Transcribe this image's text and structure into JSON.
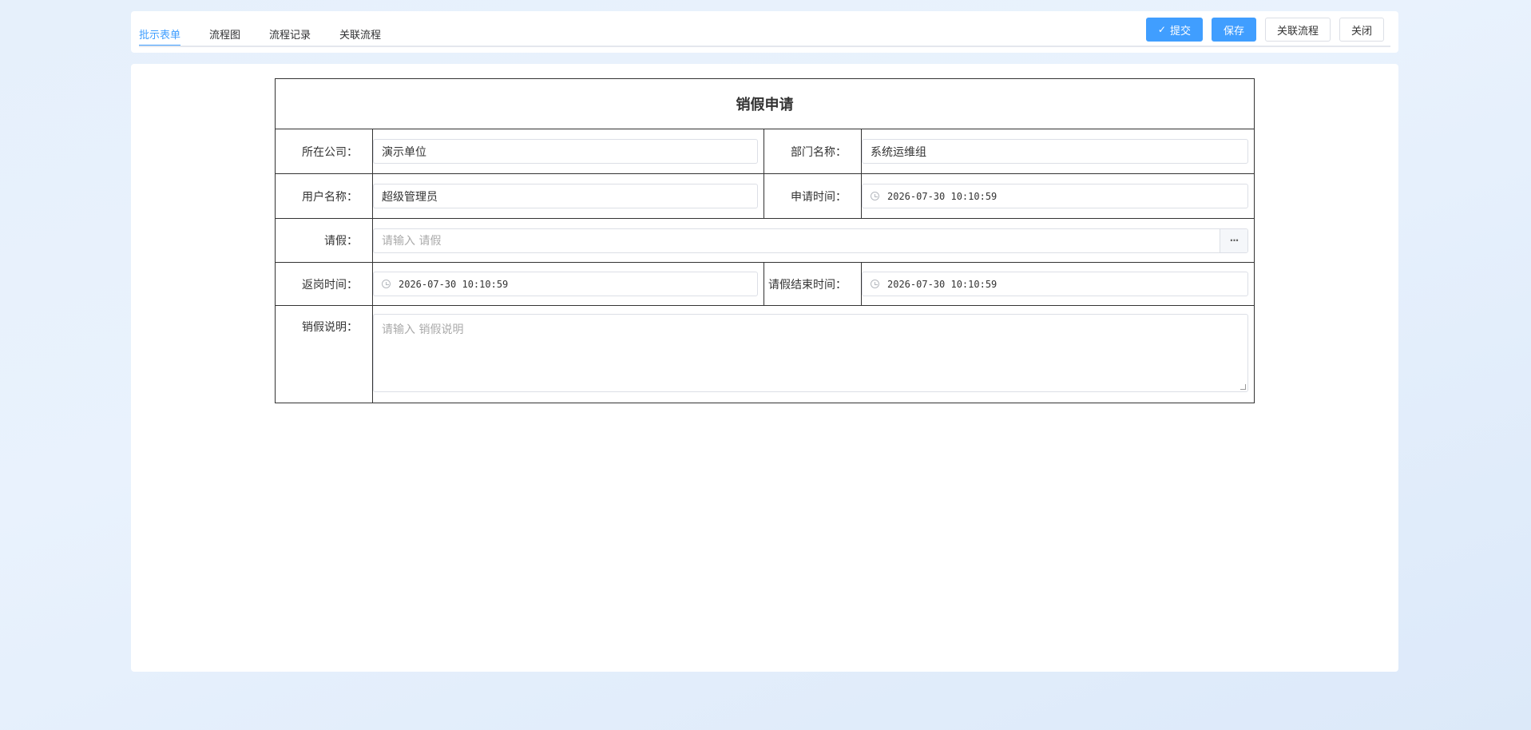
{
  "tabs": [
    {
      "label": "批示表单",
      "active": true
    },
    {
      "label": "流程图",
      "active": false
    },
    {
      "label": "流程记录",
      "active": false
    },
    {
      "label": "关联流程",
      "active": false
    }
  ],
  "actions": {
    "submit": "提交",
    "save": "保存",
    "related": "关联流程",
    "close": "关闭"
  },
  "form": {
    "title": "销假申请",
    "company": {
      "label": "所在公司：",
      "value": "演示单位"
    },
    "department": {
      "label": "部门名称：",
      "value": "系统运维组"
    },
    "user": {
      "label": "用户名称：",
      "value": "超级管理员"
    },
    "apply_time": {
      "label": "申请时间：",
      "value": "2026-07-30 10:10:59"
    },
    "leave": {
      "label": "请假：",
      "placeholder": "请输入 请假",
      "more": "···"
    },
    "return_time": {
      "label": "返岗时间：",
      "value": "2026-07-30 10:10:59"
    },
    "leave_end_time": {
      "label": "请假结束时间：",
      "value": "2026-07-30 10:10:59"
    },
    "remark": {
      "label": "销假说明：",
      "placeholder": "请输入 销假说明"
    }
  },
  "colors": {
    "accent": "#409eff",
    "border": "#333333"
  },
  "icons": [
    "check-icon",
    "clock-icon",
    "more-icon"
  ]
}
